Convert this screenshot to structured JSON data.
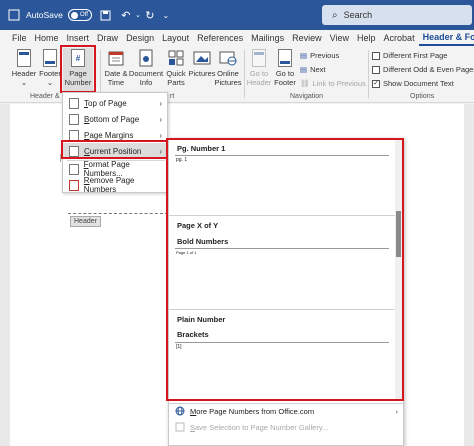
{
  "titlebar": {
    "autosave_label": "AutoSave",
    "autosave_state": "Off",
    "search_placeholder": "Search"
  },
  "tabs": [
    "File",
    "Home",
    "Insert",
    "Draw",
    "Design",
    "Layout",
    "References",
    "Mailings",
    "Review",
    "View",
    "Help",
    "Acrobat",
    "Header & Footer"
  ],
  "ribbon": {
    "header": "Header",
    "footer": "Footer",
    "page_number_1": "Page",
    "page_number_2": "Number",
    "date_time_1": "Date &",
    "date_time_2": "Time",
    "doc_info_1": "Document",
    "doc_info_2": "Info",
    "quick_parts_1": "Quick",
    "quick_parts_2": "Parts",
    "pictures": "Pictures",
    "online_pictures_1": "Online",
    "online_pictures_2": "Pictures",
    "go_to_header_1": "Go to",
    "go_to_header_2": "Header",
    "go_to_footer_1": "Go to",
    "go_to_footer_2": "Footer",
    "previous": "Previous",
    "next": "Next",
    "link_previous": "Link to Previous",
    "different_first_page": "Different First Page",
    "different_odd_even": "Different Odd & Even Pages",
    "show_document_text": "Show Document Text",
    "group_header_footer": "Header & F",
    "group_insert": "rt",
    "group_navigation": "Navigation",
    "group_options": "Options"
  },
  "page_number_menu": [
    {
      "pre": "",
      "u": "T",
      "post": "op of Page"
    },
    {
      "pre": "",
      "u": "B",
      "post": "ottom of Page"
    },
    {
      "pre": "",
      "u": "P",
      "post": "age Margins"
    },
    {
      "pre": "",
      "u": "C",
      "post": "urrent Position"
    },
    {
      "pre": "",
      "u": "F",
      "post": "ormat Page Numbers..."
    },
    {
      "pre": "",
      "u": "R",
      "post": "emove Page Numbers"
    }
  ],
  "document": {
    "header_tag": "Header"
  },
  "gallery": {
    "section1_title": "Pg. Number 1",
    "thumb1_text": "pg. 1",
    "section2_title": "Page X of Y",
    "section2_sub": "Bold Numbers",
    "thumb2_text": "Page 1 of 1",
    "section3_title": "Plain Number",
    "section3_sub": "Brackets",
    "thumb3_text": "[1]",
    "more_pre": "",
    "more_u": "M",
    "more_post": "ore Page Numbers from Office.com",
    "save_pre": "",
    "save_u": "S",
    "save_post": "ave Selection to Page Number Gallery..."
  },
  "colors": {
    "titlebar": "#2b579a",
    "highlight": "#d5171d",
    "active_tab": "#1f4e99"
  }
}
